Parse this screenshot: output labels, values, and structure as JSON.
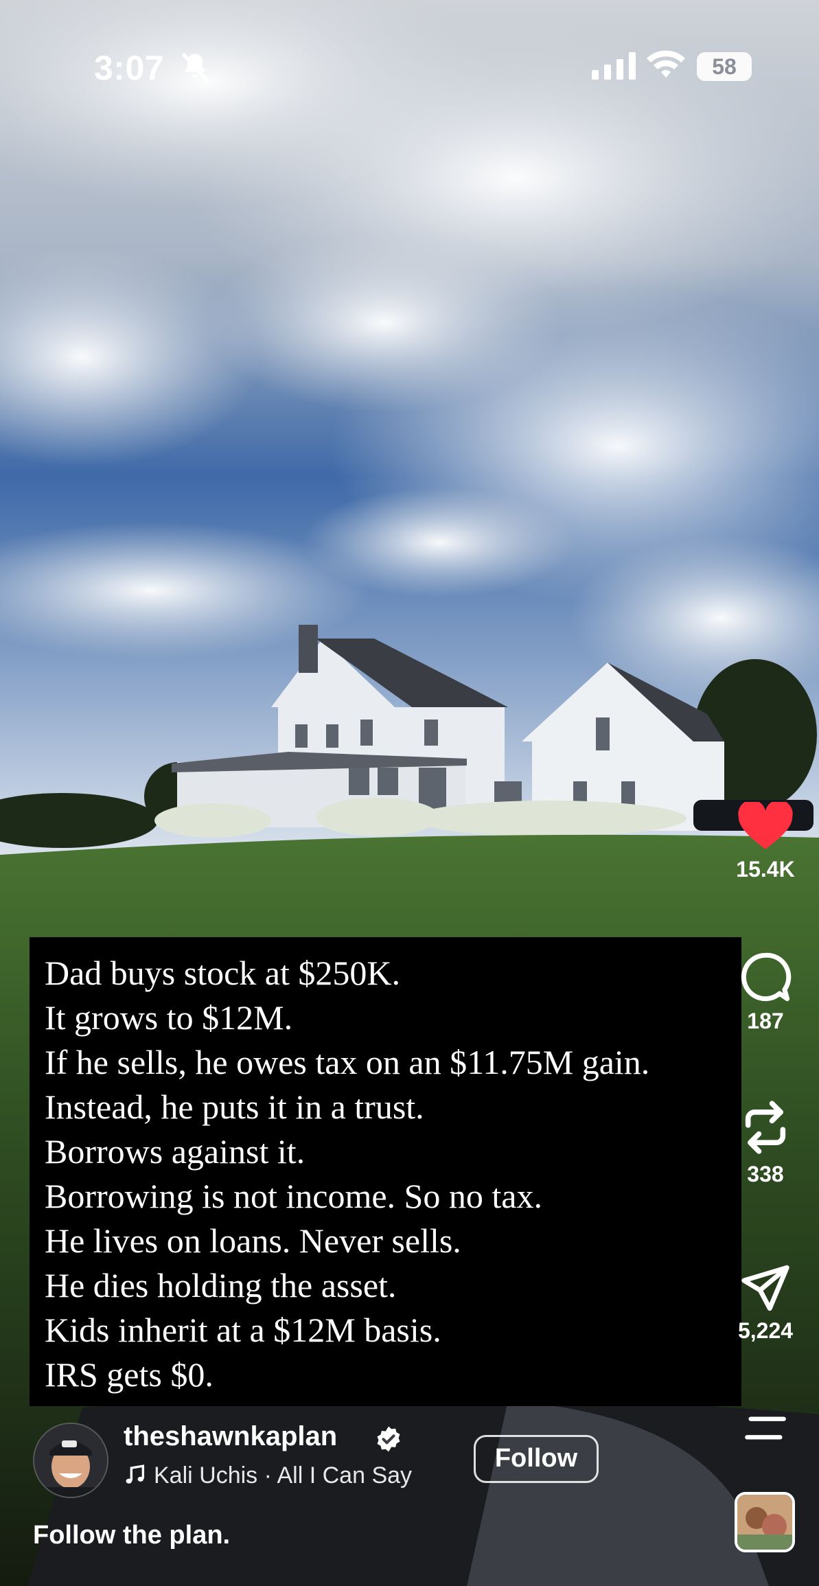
{
  "status_bar": {
    "time": "3:07",
    "battery": "58"
  },
  "overlay_text": [
    "Dad buys stock at $250K.",
    "It grows to $12M.",
    "If he sells, he owes tax on an $11.75M gain.",
    "Instead, he puts it in a trust.",
    "Borrows against it.",
    "Borrowing is not income. So no tax.",
    "He lives on loans. Never sells.",
    "He dies holding the asset.",
    "Kids inherit at a $12M basis.",
    "IRS gets $0."
  ],
  "actions": {
    "likes": "15.4K",
    "comments": "187",
    "reposts": "338",
    "shares": "5,224"
  },
  "author": {
    "username": "theshawnkaplan",
    "music": "Kali Uchis · All I Can Say",
    "follow_label": "Follow"
  },
  "caption": "Follow the plan.",
  "colors": {
    "like_red": "#ff3040",
    "sky_blue": "#3f6aa8",
    "grass_green": "#3f6b2a"
  },
  "icons": [
    "bell-slash-icon",
    "signal-icon",
    "wifi-icon",
    "heart-icon",
    "comment-icon",
    "repost-icon",
    "share-icon",
    "more-icon",
    "verified-icon",
    "music-note-icon"
  ]
}
